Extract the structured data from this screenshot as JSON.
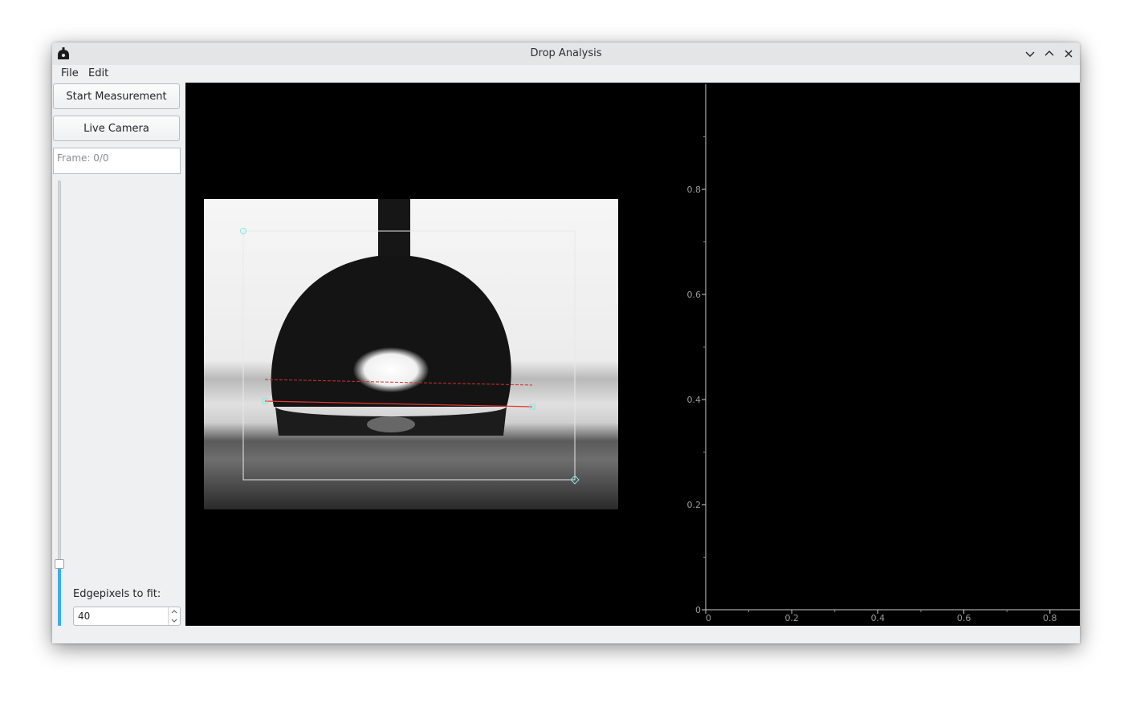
{
  "window": {
    "title": "Drop Analysis",
    "icons": [
      "app-icon",
      "minimize-icon",
      "maximize-icon",
      "close-icon"
    ]
  },
  "menu": {
    "items": [
      "File",
      "Edit"
    ]
  },
  "controls": {
    "start_label": "Start Measurement",
    "live_label": "Live Camera",
    "frame_text": "Frame: 0/0",
    "edge_label": "Edgepixels to fit:",
    "edge_value": "40",
    "slider_fraction": 0.14
  },
  "colors": {
    "accent": "#3daee9",
    "baseline": "#e53935",
    "roi_handle": "#80e8e0"
  },
  "chart_data": {
    "type": "line",
    "series": [],
    "xlim": [
      0,
      1
    ],
    "ylim": [
      0,
      1
    ],
    "x_ticks": [
      "0",
      "0.2",
      "0.4",
      "0.6",
      "0.8"
    ],
    "y_ticks": [
      "0",
      "0.2",
      "0.4",
      "0.6",
      "0.8"
    ],
    "grid": false,
    "legend": "none",
    "title": "",
    "xlabel": "",
    "ylabel": ""
  }
}
